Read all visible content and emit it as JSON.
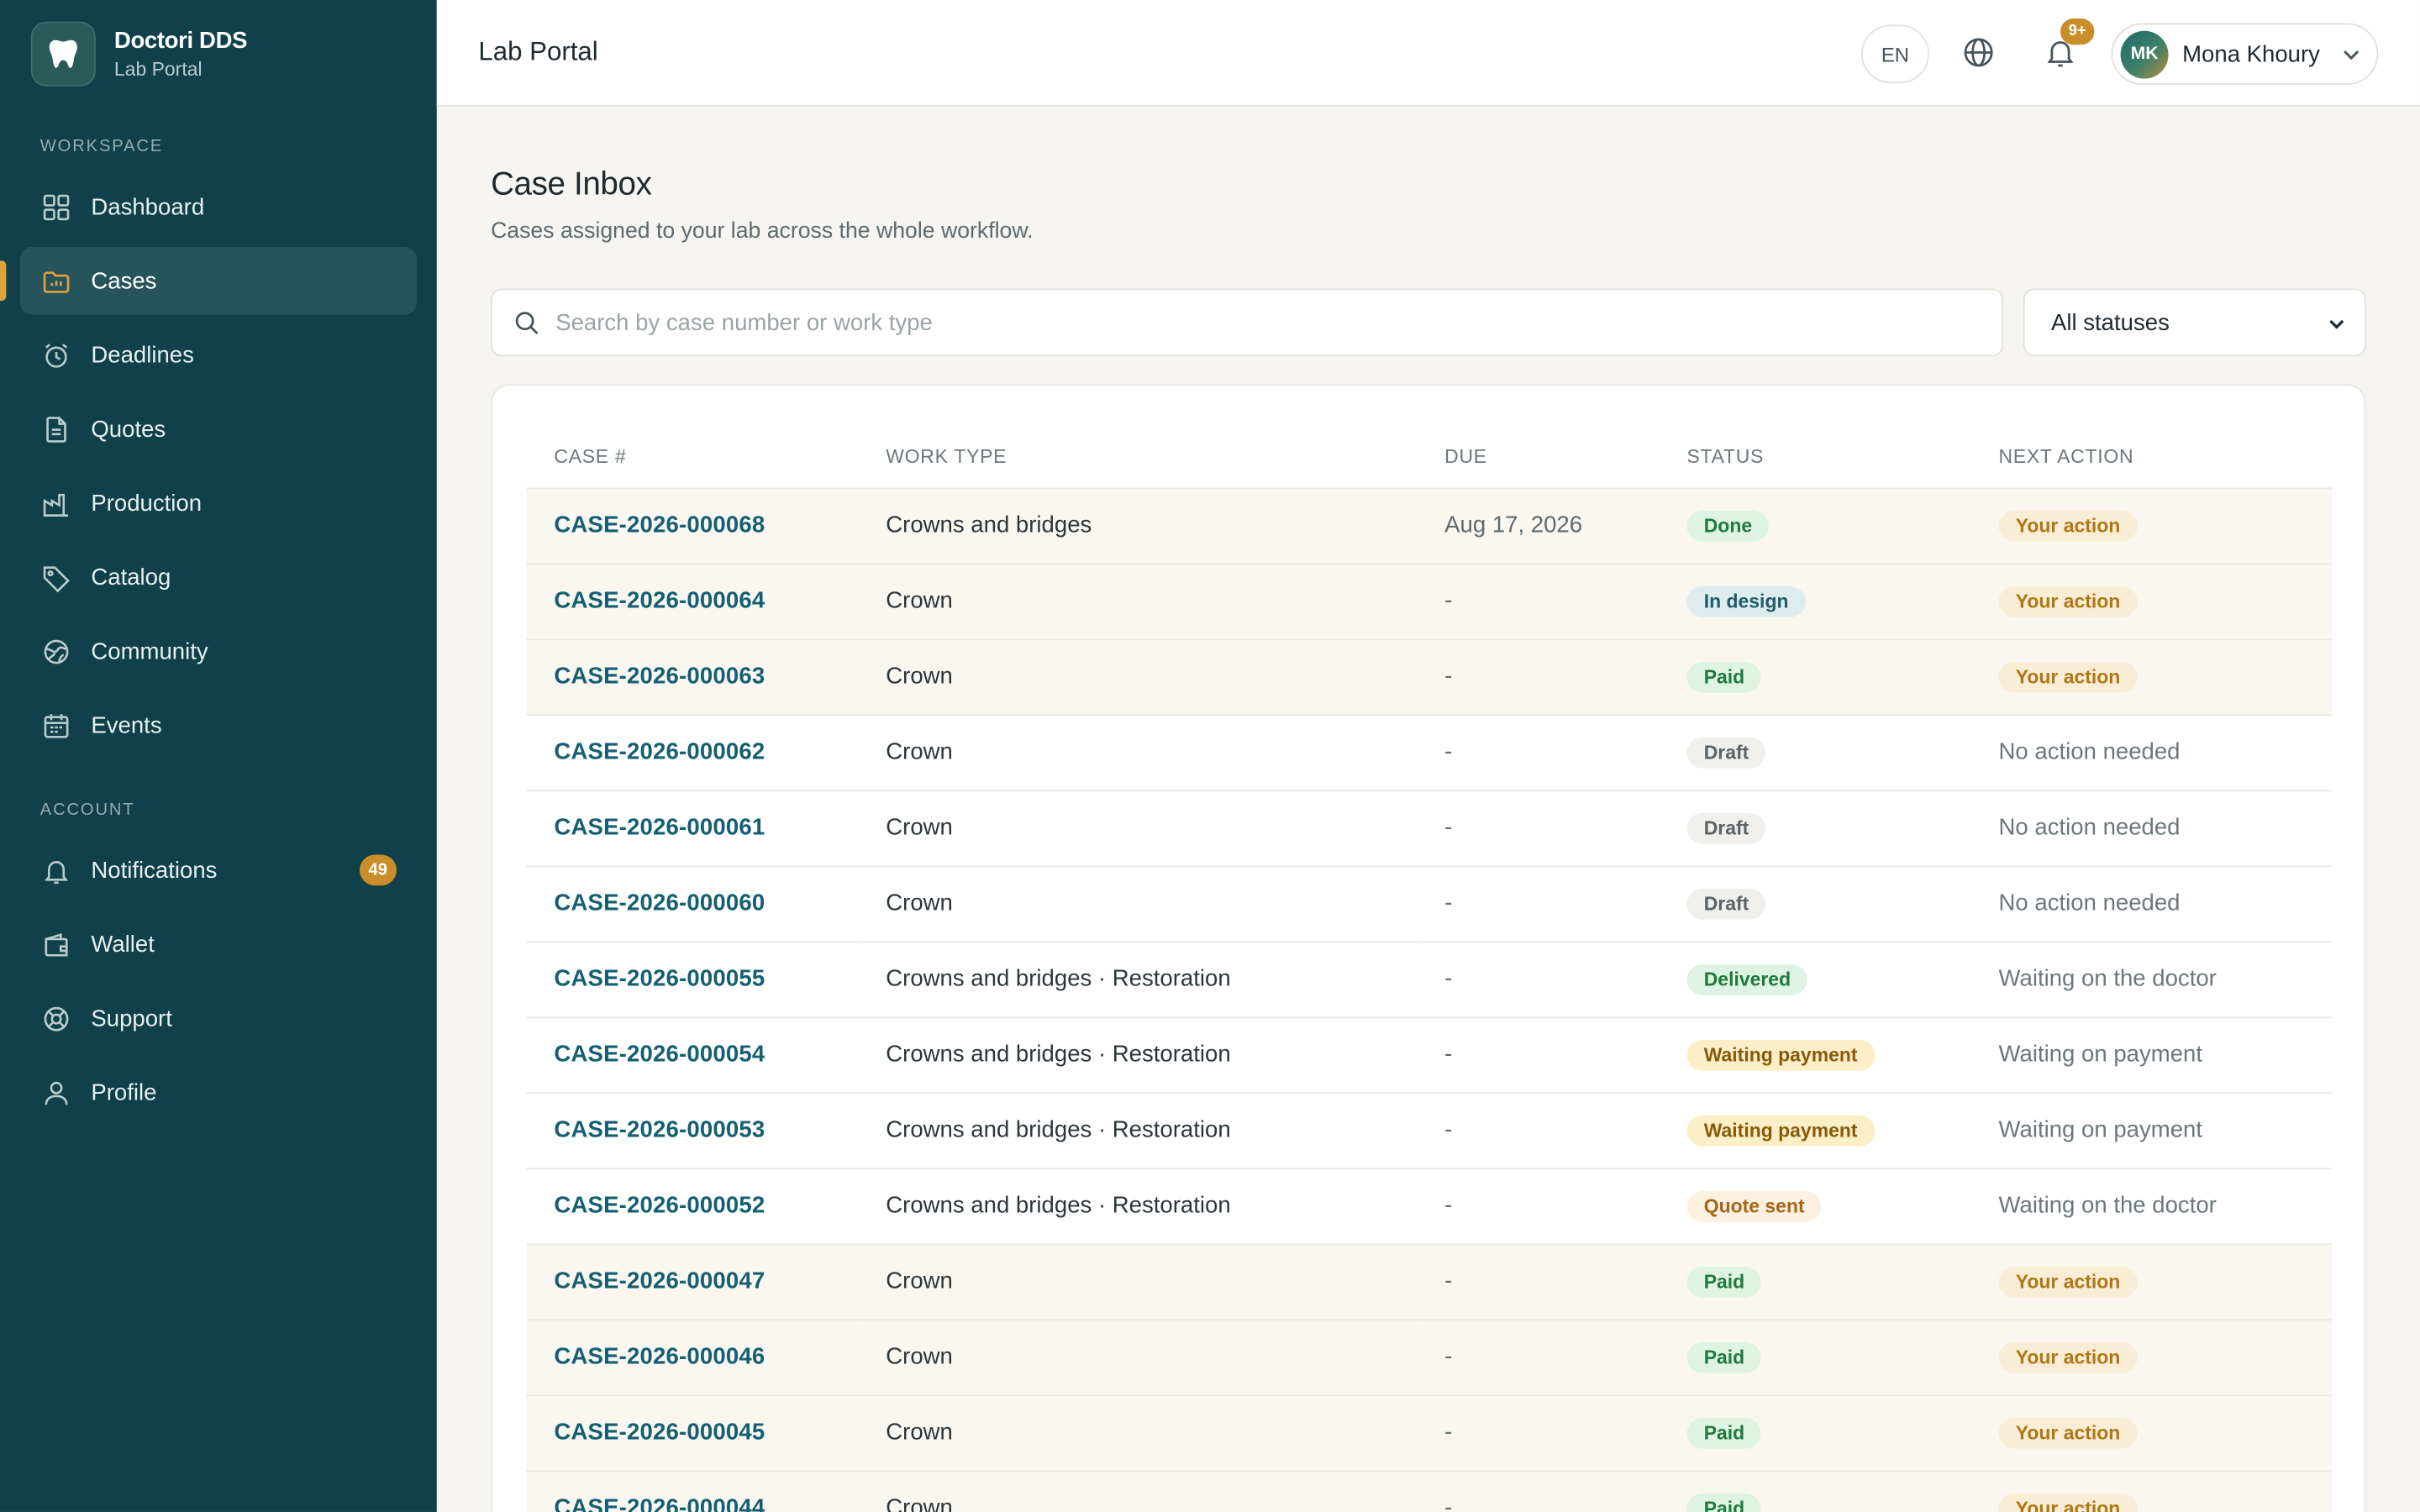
{
  "brand": {
    "title": "Doctori DDS",
    "subtitle": "Lab Portal"
  },
  "sidebar": {
    "workspace_label": "WORKSPACE",
    "account_label": "ACCOUNT",
    "workspace_items": [
      {
        "label": "Dashboard",
        "icon": "grid-icon"
      },
      {
        "label": "Cases",
        "icon": "folder-icon",
        "active": true
      },
      {
        "label": "Deadlines",
        "icon": "alarm-clock-icon"
      },
      {
        "label": "Quotes",
        "icon": "document-icon"
      },
      {
        "label": "Production",
        "icon": "factory-icon"
      },
      {
        "label": "Catalog",
        "icon": "tag-icon"
      },
      {
        "label": "Community",
        "icon": "globe-network-icon"
      },
      {
        "label": "Events",
        "icon": "calendar-icon"
      }
    ],
    "account_items": [
      {
        "label": "Notifications",
        "icon": "bell-icon",
        "badge": "49"
      },
      {
        "label": "Wallet",
        "icon": "wallet-icon"
      },
      {
        "label": "Support",
        "icon": "lifebuoy-icon"
      },
      {
        "label": "Profile",
        "icon": "user-icon"
      }
    ]
  },
  "header": {
    "title": "Lab Portal",
    "language": "EN",
    "notification_badge": "9+",
    "user": {
      "initials": "MK",
      "name": "Mona Khoury"
    }
  },
  "main": {
    "title": "Case Inbox",
    "subtitle": "Cases assigned to your lab across the whole workflow.",
    "search_placeholder": "Search by case number or work type",
    "status_filter": "All statuses"
  },
  "table": {
    "columns": [
      "CASE #",
      "WORK TYPE",
      "DUE",
      "STATUS",
      "NEXT ACTION"
    ],
    "rows": [
      {
        "case": "CASE-2026-000068",
        "work_type": "Crowns and bridges",
        "due": "Aug 17, 2026",
        "status": "Done",
        "status_kind": "done",
        "next": "Your action",
        "next_kind": "action"
      },
      {
        "case": "CASE-2026-000064",
        "work_type": "Crown",
        "due": "-",
        "status": "In design",
        "status_kind": "design",
        "next": "Your action",
        "next_kind": "action"
      },
      {
        "case": "CASE-2026-000063",
        "work_type": "Crown",
        "due": "-",
        "status": "Paid",
        "status_kind": "paid",
        "next": "Your action",
        "next_kind": "action"
      },
      {
        "case": "CASE-2026-000062",
        "work_type": "Crown",
        "due": "-",
        "status": "Draft",
        "status_kind": "draft",
        "next": "No action needed",
        "next_kind": "text"
      },
      {
        "case": "CASE-2026-000061",
        "work_type": "Crown",
        "due": "-",
        "status": "Draft",
        "status_kind": "draft",
        "next": "No action needed",
        "next_kind": "text"
      },
      {
        "case": "CASE-2026-000060",
        "work_type": "Crown",
        "due": "-",
        "status": "Draft",
        "status_kind": "draft",
        "next": "No action needed",
        "next_kind": "text"
      },
      {
        "case": "CASE-2026-000055",
        "work_type": "Crowns and bridges · Restoration",
        "due": "-",
        "status": "Delivered",
        "status_kind": "delivered",
        "next": "Waiting on the doctor",
        "next_kind": "text"
      },
      {
        "case": "CASE-2026-000054",
        "work_type": "Crowns and bridges · Restoration",
        "due": "-",
        "status": "Waiting payment",
        "status_kind": "waiting",
        "next": "Waiting on payment",
        "next_kind": "text"
      },
      {
        "case": "CASE-2026-000053",
        "work_type": "Crowns and bridges · Restoration",
        "due": "-",
        "status": "Waiting payment",
        "status_kind": "waiting",
        "next": "Waiting on payment",
        "next_kind": "text"
      },
      {
        "case": "CASE-2026-000052",
        "work_type": "Crowns and bridges · Restoration",
        "due": "-",
        "status": "Quote sent",
        "status_kind": "quote",
        "next": "Waiting on the doctor",
        "next_kind": "text"
      },
      {
        "case": "CASE-2026-000047",
        "work_type": "Crown",
        "due": "-",
        "status": "Paid",
        "status_kind": "paid",
        "next": "Your action",
        "next_kind": "action"
      },
      {
        "case": "CASE-2026-000046",
        "work_type": "Crown",
        "due": "-",
        "status": "Paid",
        "status_kind": "paid",
        "next": "Your action",
        "next_kind": "action"
      },
      {
        "case": "CASE-2026-000045",
        "work_type": "Crown",
        "due": "-",
        "status": "Paid",
        "status_kind": "paid",
        "next": "Your action",
        "next_kind": "action"
      },
      {
        "case": "CASE-2026-000044",
        "work_type": "Crown",
        "due": "-",
        "status": "Paid",
        "status_kind": "paid",
        "next": "Your action",
        "next_kind": "action"
      }
    ]
  },
  "colors": {
    "sidebar_bg": "#10404a",
    "accent": "#e0a23a",
    "badge": "#c98d2a",
    "link": "#145f72"
  }
}
